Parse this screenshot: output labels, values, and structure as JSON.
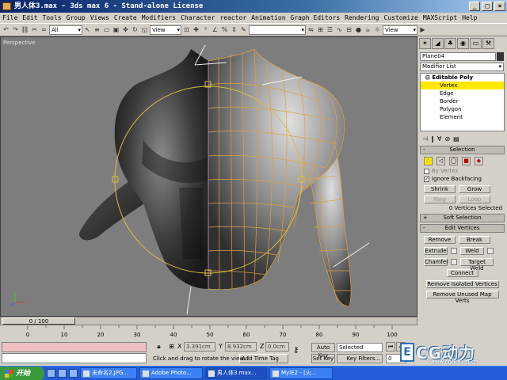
{
  "window": {
    "title": "男人体3.max - 3ds max 6 - Stand-alone License",
    "minimize": "_",
    "maximize": "□",
    "close": "×"
  },
  "menu": [
    "File",
    "Edit",
    "Tools",
    "Group",
    "Views",
    "Create",
    "Modifiers",
    "Character",
    "reactor",
    "Animation",
    "Graph Editors",
    "Rendering",
    "Customize",
    "MAXScript",
    "Help"
  ],
  "toolbar": {
    "selection_filter": "All",
    "ref_coord_system": "View",
    "named_selection": "",
    "right_dropdown": "View"
  },
  "viewport": {
    "label": "Perspective",
    "background": "#7d7d7d",
    "cage_color": "#e0a040",
    "gizmo_color": "#d8c040"
  },
  "command_panel": {
    "object_name": "Plane04",
    "object_color": "#333333",
    "modifier_list": "Modifier List",
    "stack": {
      "root": "Editable Poly",
      "items": [
        "Vertex",
        "Edge",
        "Border",
        "Polygon",
        "Element"
      ],
      "selected": "Vertex"
    },
    "selection": {
      "title": "Selection",
      "by_vertex": "By Vertex",
      "ignore_backfacing": "Ignore Backfacing",
      "ignore_backfacing_checked": true,
      "shrink": "Shrink",
      "grow": "Grow",
      "ring": "Ring",
      "loop": "Loop",
      "status": "0 Vertices Selected"
    },
    "soft_selection": {
      "title": "Soft Selection",
      "sign": "+"
    },
    "edit_vertices": {
      "title": "Edit Vertices",
      "sign": "-",
      "remove": "Remove",
      "break": "Break",
      "extrude": "Extrude",
      "weld": "Weld",
      "chamfer": "Chamfer",
      "target_weld": "Target Weld",
      "connect": "Connect",
      "remove_isolated": "Remove Isolated Vertices",
      "remove_unused": "Remove Unused Map Verts"
    },
    "selection_sign": "-"
  },
  "timeline": {
    "frame_readout": "0 / 100",
    "ticks": [
      "0",
      "10",
      "20",
      "30",
      "40",
      "50",
      "60",
      "70",
      "80",
      "90",
      "100"
    ]
  },
  "status": {
    "x_label": "X",
    "x_value": "3.391cm",
    "y_label": "Y",
    "y_value": "8.932cm",
    "z_label": "Z",
    "z_value": "0.0cm",
    "prompt": "Click and drag to rotate the view. I",
    "add_time_tag": "Add Time Tag",
    "auto_key": "Auto Key",
    "set_key": "Set Key",
    "key_mode": "Selected",
    "key_filters": "Key Filters...",
    "current_frame": "0"
  },
  "watermark": {
    "text": "CG动力",
    "url": "www.cgdream.cn",
    "letter": "E"
  },
  "taskbar": {
    "start": "开始",
    "tasks": [
      "未命名2.JPG...",
      "Adobe Photo...",
      "男人体3.max...",
      "MyIE2 - [火..."
    ],
    "active_index": 2
  }
}
